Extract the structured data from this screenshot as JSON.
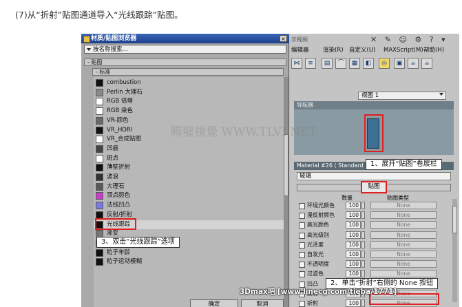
{
  "caption": "(7)从“折射”贴图通道导入“光线跟踪”贴图。",
  "dialog": {
    "title": "材质/贴图浏览器",
    "close": "×",
    "search_placeholder": "按名称搜索...",
    "rollout_maps": "- 贴图",
    "rollout_standard": "- 标准",
    "ok_label": "确定",
    "cancel_label": "取消",
    "map_items": [
      {
        "label": "combustion",
        "color": "#111111"
      },
      {
        "label": "Perlin 大理石",
        "color": "#8a8a8a"
      },
      {
        "label": "RGB 倍增",
        "color": "#ffffff"
      },
      {
        "label": "RGB 染色",
        "color": "#ffffff"
      },
      {
        "label": "VR-颜色",
        "color": "#6a6a6a"
      },
      {
        "label": "VR_HDRI",
        "color": "#111111"
      },
      {
        "label": "VR_合成贴图",
        "color": "#ffffff"
      },
      {
        "label": "凹痕",
        "color": "#444444"
      },
      {
        "label": "斑点",
        "color": "#ffffff"
      },
      {
        "label": "薄壁折射",
        "color": "#111111"
      },
      {
        "label": "波浪",
        "color": "#333333"
      },
      {
        "label": "大理石",
        "color": "#5a5a5a"
      },
      {
        "label": "顶点颜色",
        "color": "#c83cc8"
      },
      {
        "label": "法线凹凸",
        "color": "#7a7ae0"
      },
      {
        "label": "反射/折射",
        "color": "#111111"
      },
      {
        "label": "光线跟踪",
        "color": "#111111"
      },
      {
        "label": "渐变",
        "color": "#777777"
      },
      {
        "label": "渐变坡度",
        "color": "#999999"
      },
      {
        "label": "粒子年龄",
        "color": "#111111"
      },
      {
        "label": "粒子运动模糊",
        "color": "#111111"
      }
    ]
  },
  "app": {
    "title_fragment": "示视频",
    "menus": [
      "编辑器",
      "渲染(R)",
      "自定义(U)",
      "MAXScript(M)",
      "帮助(H)"
    ],
    "view_label": "视图 1",
    "navigator_label": "导航器",
    "material_title": "Material #26 ( Standard )",
    "glass_label": "玻璃",
    "maps_rollout_label": "贴图",
    "col_amount": "数量",
    "col_maptype": "贴图类型",
    "map_rows": [
      {
        "name": "环境光颜色",
        "amount": "100",
        "map": "None"
      },
      {
        "name": "漫反射颜色",
        "amount": "100",
        "map": "None"
      },
      {
        "name": "高光颜色",
        "amount": "100",
        "map": "None"
      },
      {
        "name": "高光级别",
        "amount": "100",
        "map": "None"
      },
      {
        "name": "光泽度",
        "amount": "100",
        "map": "None"
      },
      {
        "name": "自发光",
        "amount": "100",
        "map": "None"
      },
      {
        "name": "不透明度",
        "amount": "100",
        "map": "None"
      },
      {
        "name": "过滤色",
        "amount": "100",
        "map": "None"
      },
      {
        "name": "凹凸",
        "amount": "30",
        "map": "None"
      },
      {
        "name": "反射",
        "amount": "100",
        "map": "None"
      },
      {
        "name": "折射",
        "amount": "100",
        "map": "None"
      }
    ]
  },
  "callouts": {
    "step1": "1、展开“贴图”卷展栏",
    "step2": "2、单击“折射”右侧的 None 按钮",
    "step3": "3、双击“光线跟踪”选项"
  },
  "watermark": "腾龍視覺 WWW.TLVI.NET",
  "credit": "3Dmax吧 [www.linecg.com/tieba/1771]"
}
